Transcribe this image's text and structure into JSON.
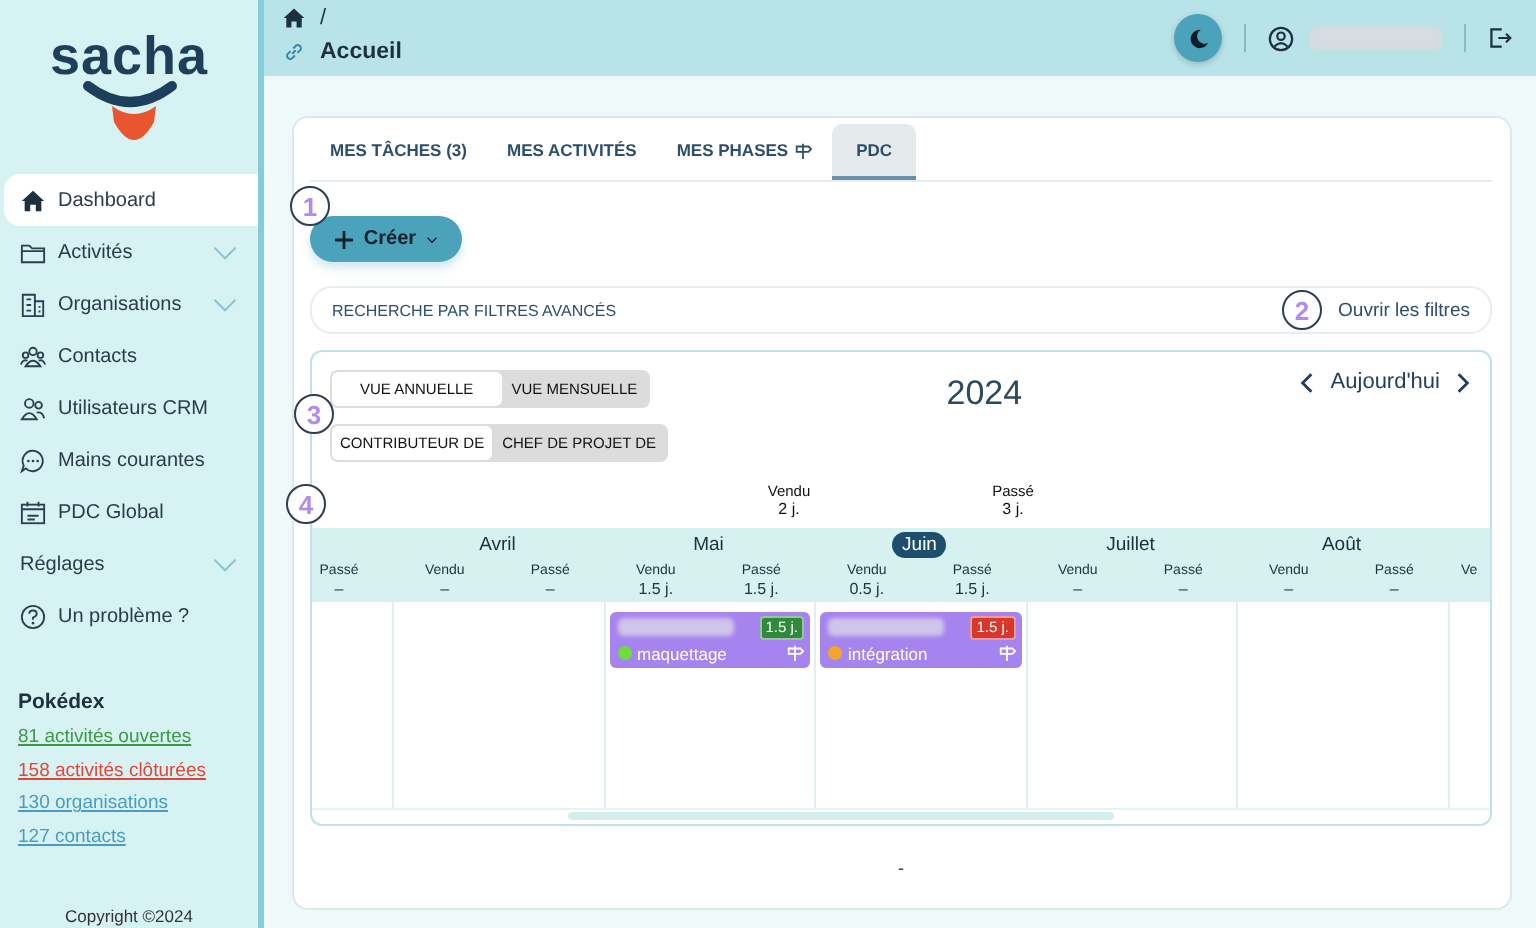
{
  "sidebar": {
    "logo": "sacha",
    "items": [
      {
        "label": "Dashboard",
        "selected": true
      },
      {
        "label": "Activités",
        "selected": false,
        "expanded": false
      },
      {
        "label": "Organisations",
        "selected": false,
        "expanded": false
      },
      {
        "label": "Contacts",
        "selected": false
      },
      {
        "label": "Utilisateurs CRM",
        "selected": false
      },
      {
        "label": "Mains courantes",
        "selected": false
      },
      {
        "label": "PDC Global",
        "selected": false
      },
      {
        "label": "Réglages",
        "selected": false,
        "expanded": false
      },
      {
        "label": "Un problème ?",
        "selected": false
      }
    ],
    "pokedex": {
      "title": "Pokédex",
      "links": [
        {
          "label": "81 activités ouvertes",
          "color": "#3c9a44"
        },
        {
          "label": "158 activités clôturées",
          "color": "#e0473b"
        },
        {
          "label": "130 organisations",
          "color": "#4a9cc4"
        },
        {
          "label": "127 contacts",
          "color": "#4a9cc4"
        }
      ]
    },
    "copyright": "Copyright ©2024"
  },
  "header": {
    "breadcrumb": "/",
    "page_title": "Accueil"
  },
  "tabs": [
    {
      "label": "MES TÂCHES (3)",
      "selected": false
    },
    {
      "label": "MES ACTIVITÉS",
      "selected": false
    },
    {
      "label": "MES PHASES",
      "selected": false
    },
    {
      "label": "PDC",
      "selected": true
    }
  ],
  "create_button": "Créer",
  "filter_bar": {
    "label": "RECHERCHE PAR FILTRES AVANCÉS",
    "action": "Ouvrir les filtres"
  },
  "calendar": {
    "view_toggle": [
      {
        "label": "VUE ANNUELLE",
        "selected": true
      },
      {
        "label": "VUE MENSUELLE",
        "selected": false
      }
    ],
    "role_toggle": [
      {
        "label": "CONTRIBUTEUR DE",
        "selected": true
      },
      {
        "label": "CHEF DE PROJET DE",
        "selected": false
      }
    ],
    "year": "2024",
    "today": "Aujourd'hui",
    "totals": [
      {
        "label": "Vendu",
        "value": "2 j."
      },
      {
        "label": "Passé",
        "value": "3 j."
      }
    ],
    "months": [
      {
        "columns": [
          {
            "label": "Passé",
            "value": "–"
          }
        ]
      },
      {
        "name": "Avril",
        "selected": false,
        "columns": [
          {
            "label": "Vendu",
            "value": "–"
          },
          {
            "label": "Passé",
            "value": "–"
          }
        ]
      },
      {
        "name": "Mai",
        "selected": false,
        "columns": [
          {
            "label": "Vendu",
            "value": "1.5 j."
          },
          {
            "label": "Passé",
            "value": "1.5 j."
          }
        ],
        "events": [
          {
            "duration": {
              "label": "1.5 j.",
              "color": "#2f8a3c"
            },
            "status": {
              "color": "#6fdc3c"
            },
            "label": "maquettage"
          }
        ]
      },
      {
        "name": "Juin",
        "selected": true,
        "columns": [
          {
            "label": "Vendu",
            "value": "0.5 j."
          },
          {
            "label": "Passé",
            "value": "1.5 j."
          }
        ],
        "events": [
          {
            "duration": {
              "label": "1.5 j.",
              "color": "#d9362c"
            },
            "status": {
              "color": "#f2a52a"
            },
            "label": "intégration"
          }
        ]
      },
      {
        "name": "Juillet",
        "selected": false,
        "columns": [
          {
            "label": "Vendu",
            "value": "–"
          },
          {
            "label": "Passé",
            "value": "–"
          }
        ]
      },
      {
        "name": "Août",
        "selected": false,
        "columns": [
          {
            "label": "Vendu",
            "value": "–"
          },
          {
            "label": "Passé",
            "value": "–"
          }
        ]
      },
      {
        "columns": [
          {
            "label": "Ve"
          }
        ]
      }
    ]
  },
  "footer": "-",
  "markers": [
    "1",
    "2",
    "3",
    "4"
  ]
}
